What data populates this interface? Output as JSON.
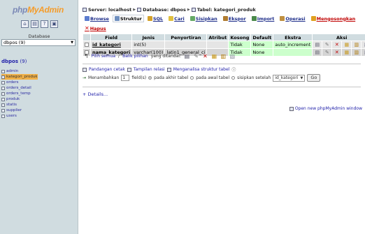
{
  "left": {
    "logo_part1": "php",
    "logo_part2": "MyAdmin",
    "icons": [
      "home-icon",
      "sql-query-icon",
      "docs-icon",
      "reload-icon"
    ],
    "icon_glyphs": [
      "⌂",
      "▤",
      "?",
      "▣"
    ],
    "database_label": "Database",
    "database_select": "dbpos (9)",
    "db_heading": "dbpos",
    "db_count": "(9)",
    "tables": [
      {
        "name": "admin",
        "active": false
      },
      {
        "name": "kategori_produk",
        "active": true
      },
      {
        "name": "orders",
        "active": false
      },
      {
        "name": "orders_detail",
        "active": false
      },
      {
        "name": "orders_temp",
        "active": false
      },
      {
        "name": "produk",
        "active": false
      },
      {
        "name": "statis",
        "active": false
      },
      {
        "name": "supplier",
        "active": false
      },
      {
        "name": "users",
        "active": false
      }
    ]
  },
  "breadcrumb": {
    "server": "Server: localhost",
    "database": "Database: dbpos",
    "table": "Tabel: kategori_produk"
  },
  "tabs": [
    {
      "label": "Browse",
      "active": false,
      "red": false,
      "icon_color": "#5b7ccf"
    },
    {
      "label": "Struktur",
      "active": true,
      "red": false,
      "icon_color": "#6f8fbf"
    },
    {
      "label": "SQL",
      "active": false,
      "red": false,
      "icon_color": "#d4a12a"
    },
    {
      "label": "Cari",
      "active": false,
      "red": false,
      "icon_color": "#e0c040"
    },
    {
      "label": "Sisipkan",
      "active": false,
      "red": false,
      "icon_color": "#66aa66"
    },
    {
      "label": "Ekspor",
      "active": false,
      "red": false,
      "icon_color": "#b07c30"
    },
    {
      "label": "Import",
      "active": false,
      "red": false,
      "icon_color": "#4a8a4a"
    },
    {
      "label": "Operasi",
      "active": false,
      "red": false,
      "icon_color": "#c09040"
    },
    {
      "label": "Mengosongkan",
      "active": false,
      "red": true,
      "icon_color": "#e0a020"
    }
  ],
  "hapus_label": "Hapus",
  "table": {
    "headers": [
      "Field",
      "Jenis",
      "Penyortiran",
      "Atribut",
      "Kosong",
      "Default",
      "Ekstra",
      "Aksi"
    ],
    "rows": [
      {
        "field": "id_kategori",
        "primary": true,
        "jenis": "int(5)",
        "penyortiran": "",
        "atribut": "",
        "kosong": "Tidak",
        "default": "None",
        "ekstra": "auto_increment"
      },
      {
        "field": "nama_kategori",
        "primary": false,
        "jenis": "varchar(100)",
        "penyortiran": "latin1_general_ci",
        "atribut": "",
        "kosong": "Tidak",
        "default": "None",
        "ekstra": ""
      }
    ]
  },
  "check_all": "Pilih semua",
  "slash": " / ",
  "uncheck_all": "Balik pilihan",
  "with_selected": "yang ditandai:",
  "tools": {
    "print": "Pandangan cetak",
    "relation": "Tampilan relasi",
    "analyze": "Menganalisa struktur tabel"
  },
  "add_fields": {
    "label": "Menambahkan",
    "count": "1",
    "fields": "field(s)",
    "at_end": "pada akhir tabel",
    "at_begin": "pada awal tabel",
    "after": "sisipkan setelah",
    "after_field": "id_kategori",
    "go": "Go"
  },
  "details": "+ Details...",
  "new_window": "Open new phpMyAdmin window"
}
